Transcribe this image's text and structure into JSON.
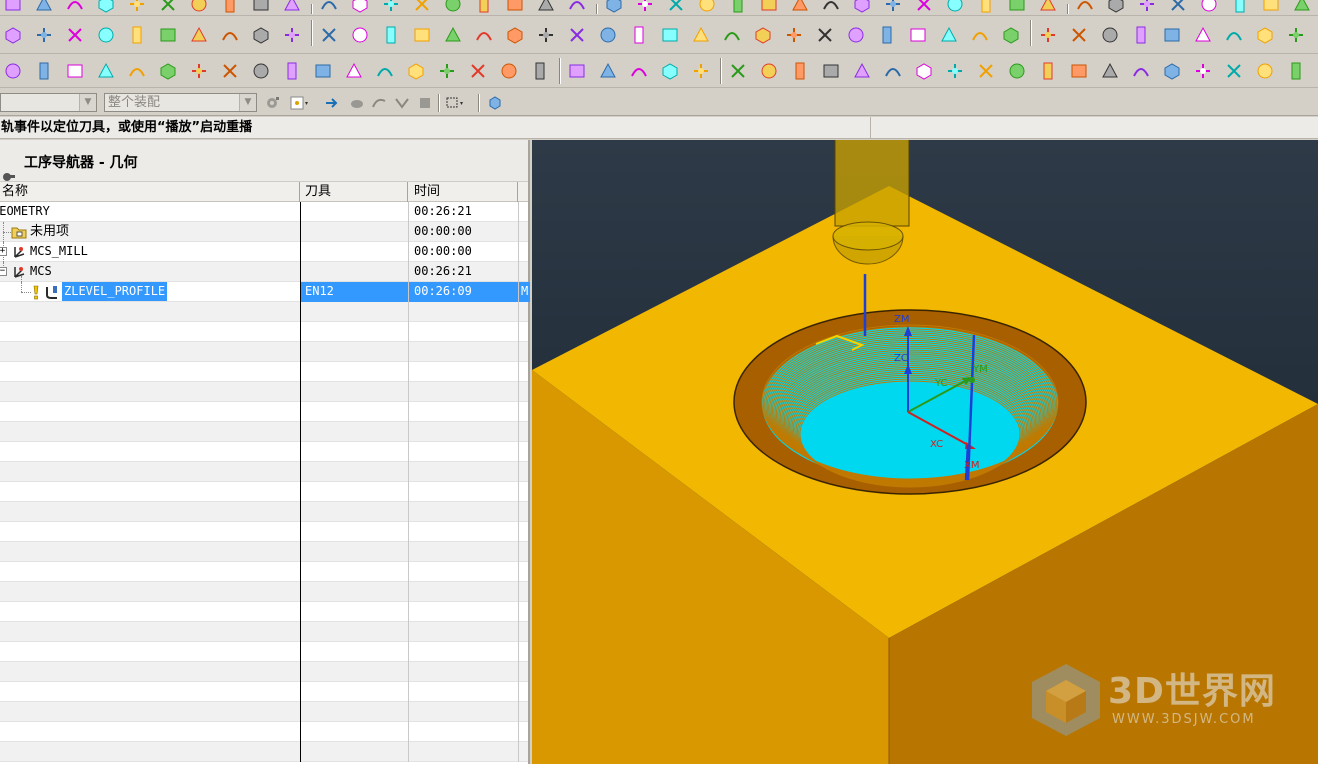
{
  "selection_bar": {
    "filter_combo": "",
    "scope_combo": "整个装配"
  },
  "cue_line": {
    "text": "轨事件以定位刀具，或使用“播放”启动重播"
  },
  "navigator": {
    "title": "工序导航器 - 几何",
    "columns": {
      "name": "名称",
      "tool": "刀具",
      "time": "时间"
    },
    "rows": [
      {
        "name": "GEOMETRY",
        "tool": "",
        "time": "00:26:21",
        "ext": ""
      },
      {
        "name": "未用项",
        "tool": "",
        "time": "00:00:00",
        "ext": ""
      },
      {
        "name": "MCS_MILL",
        "tool": "",
        "time": "00:00:00",
        "ext": ""
      },
      {
        "name": "MCS",
        "tool": "",
        "time": "00:26:21",
        "ext": ""
      },
      {
        "name": "ZLEVEL_PROFILE",
        "tool": "EN12",
        "time": "00:26:09",
        "ext": "M"
      }
    ]
  },
  "viewport": {
    "labels": {
      "zm_top": "ZM",
      "zc": "ZC",
      "yc": "YC",
      "ym": "YM",
      "xc": "XC",
      "xm": "XM",
      "bottom_tag": "Z"
    },
    "colors": {
      "stock": "#f2b700",
      "stock_side_left": "#d99800",
      "stock_side_right": "#b87600",
      "toolpath": "#00e5ff",
      "tool": "#c9a200"
    }
  },
  "watermark": {
    "name": "3D世界网",
    "url": "WWW.3DSJW.COM"
  }
}
